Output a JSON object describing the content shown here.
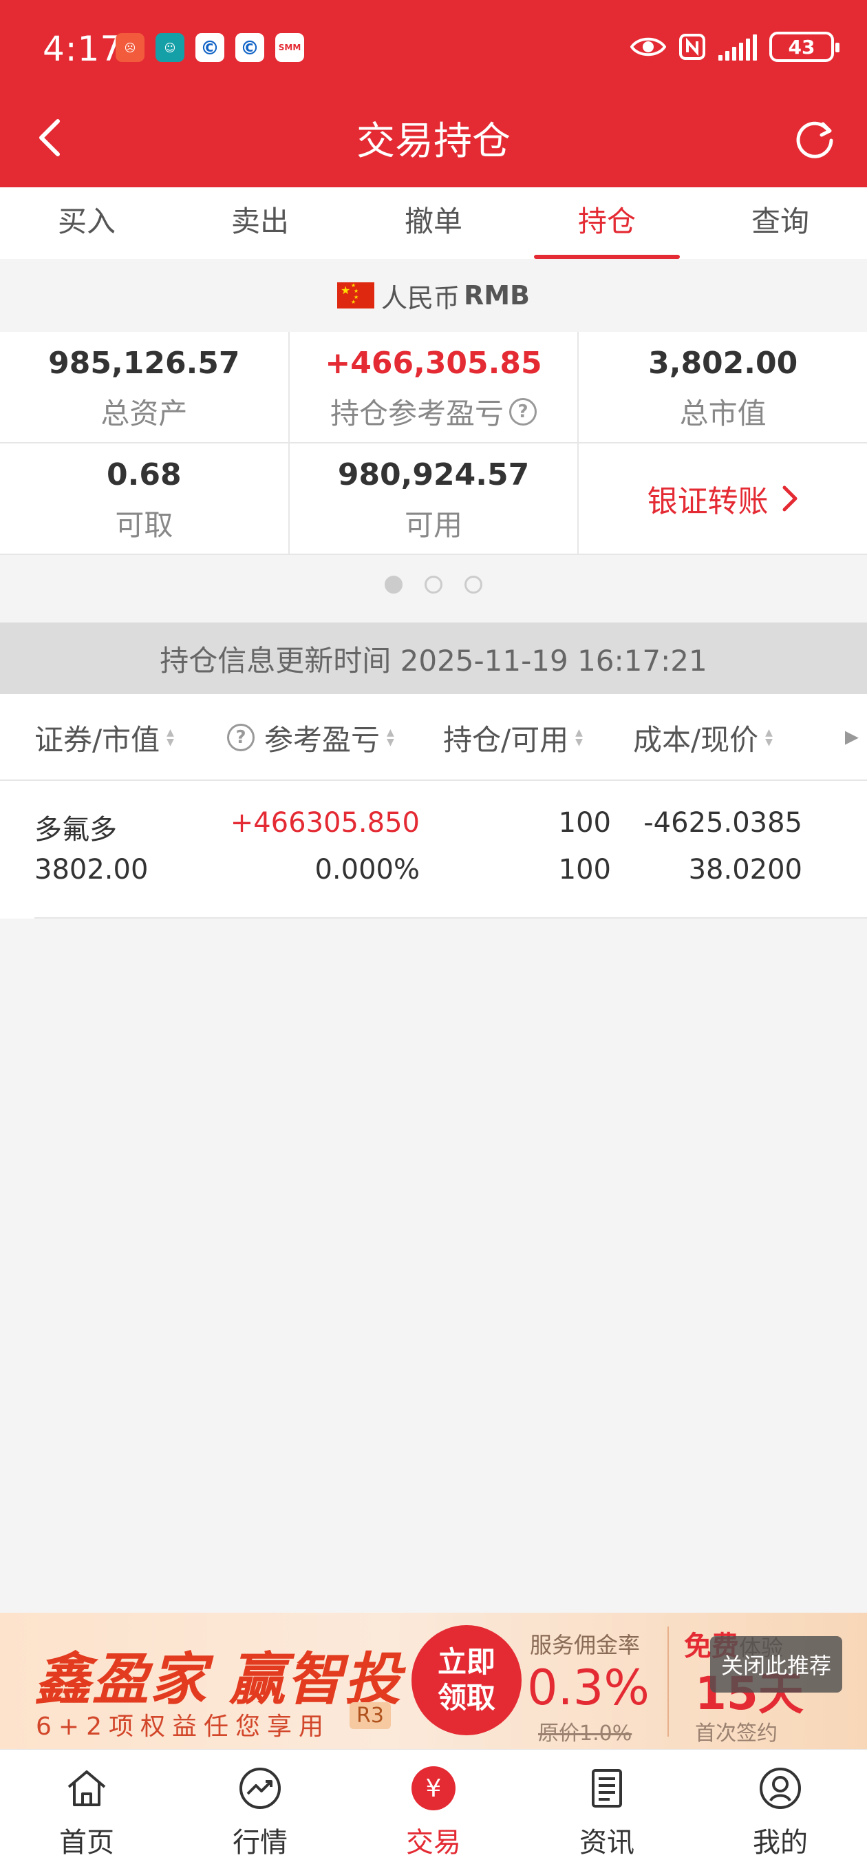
{
  "status": {
    "time": "4:17",
    "battery": "43",
    "apps": [
      {
        "icon": "weibo-icon",
        "color": "#f25b3c",
        "text": ""
      },
      {
        "icon": "chat-bot-icon",
        "color": "#15a0a8",
        "text": ""
      },
      {
        "icon": "bank-c-icon",
        "color": "#1163c6",
        "text": "C"
      },
      {
        "icon": "bank-c2-icon",
        "color": "#1163c6",
        "text": "C"
      },
      {
        "icon": "smm-icon",
        "color": "#e42a33",
        "text": "SMM"
      }
    ]
  },
  "header": {
    "title": "交易持仓"
  },
  "tabs": [
    {
      "label": "买入"
    },
    {
      "label": "卖出"
    },
    {
      "label": "撤单"
    },
    {
      "label": "持仓"
    },
    {
      "label": "查询"
    }
  ],
  "currency": {
    "label": "人民币",
    "code": "RMB"
  },
  "summary": {
    "total_assets": {
      "value": "985,126.57",
      "label": "总资产"
    },
    "position_pnl": {
      "value": "+466,305.85",
      "label": "持仓参考盈亏"
    },
    "market_value": {
      "value": "3,802.00",
      "label": "总市值"
    },
    "withdrawable": {
      "value": "0.68",
      "label": "可取"
    },
    "available": {
      "value": "980,924.57",
      "label": "可用"
    },
    "transfer": {
      "label": "银证转账"
    }
  },
  "update": {
    "text": "持仓信息更新时间 2025-11-19 16:17:21"
  },
  "table": {
    "headers": [
      "证券/市值",
      "参考盈亏",
      "持仓/可用",
      "成本/现价"
    ],
    "rows": [
      {
        "name": "多氟多",
        "market_value": "3802.00",
        "pnl": "+466305.850",
        "pnl_pct": "0.000%",
        "position": "100",
        "available": "100",
        "cost": "-4625.0385",
        "price": "38.0200"
      }
    ]
  },
  "ad": {
    "title": "鑫盈家 赢智投",
    "subtitle": "6+2项权益任您享用",
    "badge": "R3",
    "cta_line1": "立即",
    "cta_line2": "领取",
    "rate_label": "服务佣金率",
    "rate": "0.3%",
    "orig_rate": "原价1.0%",
    "free_word": "免费",
    "free_suffix": "体验",
    "days": "15天",
    "first_sign": "首次签约",
    "close_label": "关闭此推荐"
  },
  "bottom_nav": [
    {
      "label": "首页"
    },
    {
      "label": "行情"
    },
    {
      "label": "交易"
    },
    {
      "label": "资讯"
    },
    {
      "label": "我的"
    }
  ],
  "colors": {
    "brand": "#e42a33",
    "profit": "#e42a33"
  }
}
